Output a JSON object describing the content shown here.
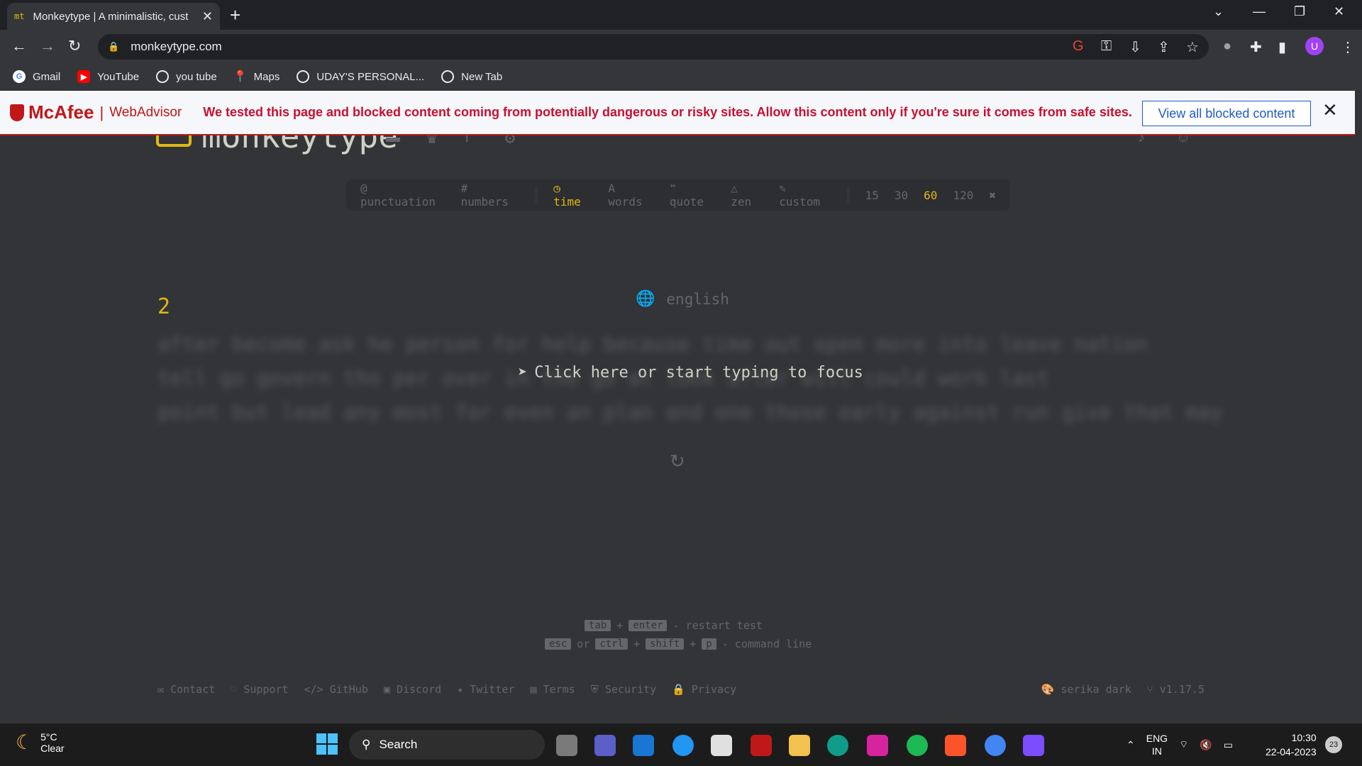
{
  "browser": {
    "tab_title": "Monkeytype | A minimalistic, cust",
    "tab_favicon": "mt",
    "url": "monkeytype.com",
    "profile_initial": "U"
  },
  "bookmarks": [
    {
      "label": "Gmail",
      "icon": "google-icon"
    },
    {
      "label": "YouTube",
      "icon": "youtube-icon"
    },
    {
      "label": "you tube",
      "icon": "globe-icon"
    },
    {
      "label": "Maps",
      "icon": "maps-icon"
    },
    {
      "label": "UDAY'S PERSONAL...",
      "icon": "globe-icon"
    },
    {
      "label": "New Tab",
      "icon": "globe-icon"
    }
  ],
  "mcafee": {
    "brand": "McAfee",
    "product": "WebAdvisor",
    "message": "We tested this page and blocked content coming from potentially dangerous or risky sites. Allow this content only if you're sure it comes from safe sites.",
    "button": "View all blocked content"
  },
  "monkeytype": {
    "logo_text": "monkeytype",
    "config": {
      "punctuation": "punctuation",
      "numbers": "numbers",
      "time": "time",
      "words": "words",
      "quote": "quote",
      "zen": "zen",
      "custom": "custom",
      "durations": [
        "15",
        "30",
        "60",
        "120"
      ],
      "selected_duration": "60"
    },
    "language": "english",
    "timer": "2",
    "words_lines": [
      "after become ask he person for help because time out open more into leave nation",
      "tell go govern tho per over in the go at look after will could work last",
      "point but lead any most for even an plan and one those early against run give that may"
    ],
    "focus_message": "Click here or start typing to focus",
    "hints": {
      "tab": "tab",
      "plus": "+",
      "enter": "enter",
      "restart": "- restart test",
      "esc": "esc",
      "or": "or",
      "ctrl": "ctrl",
      "shift": "shift",
      "p": "p",
      "command": "- command line"
    },
    "footer_links": [
      "Contact",
      "Support",
      "GitHub",
      "Discord",
      "Twitter",
      "Terms",
      "Security",
      "Privacy"
    ],
    "theme": "serika dark",
    "version": "v1.17.5",
    "colors": {
      "bg": "#323437",
      "main": "#e2b714",
      "sub": "#646669",
      "text": "#d1d0c5"
    }
  },
  "taskbar": {
    "temperature": "5°C",
    "condition": "Clear",
    "search_label": "Search",
    "lang_top": "ENG",
    "lang_bottom": "IN",
    "time": "10:30",
    "date": "22-04-2023",
    "notifications": "23"
  }
}
